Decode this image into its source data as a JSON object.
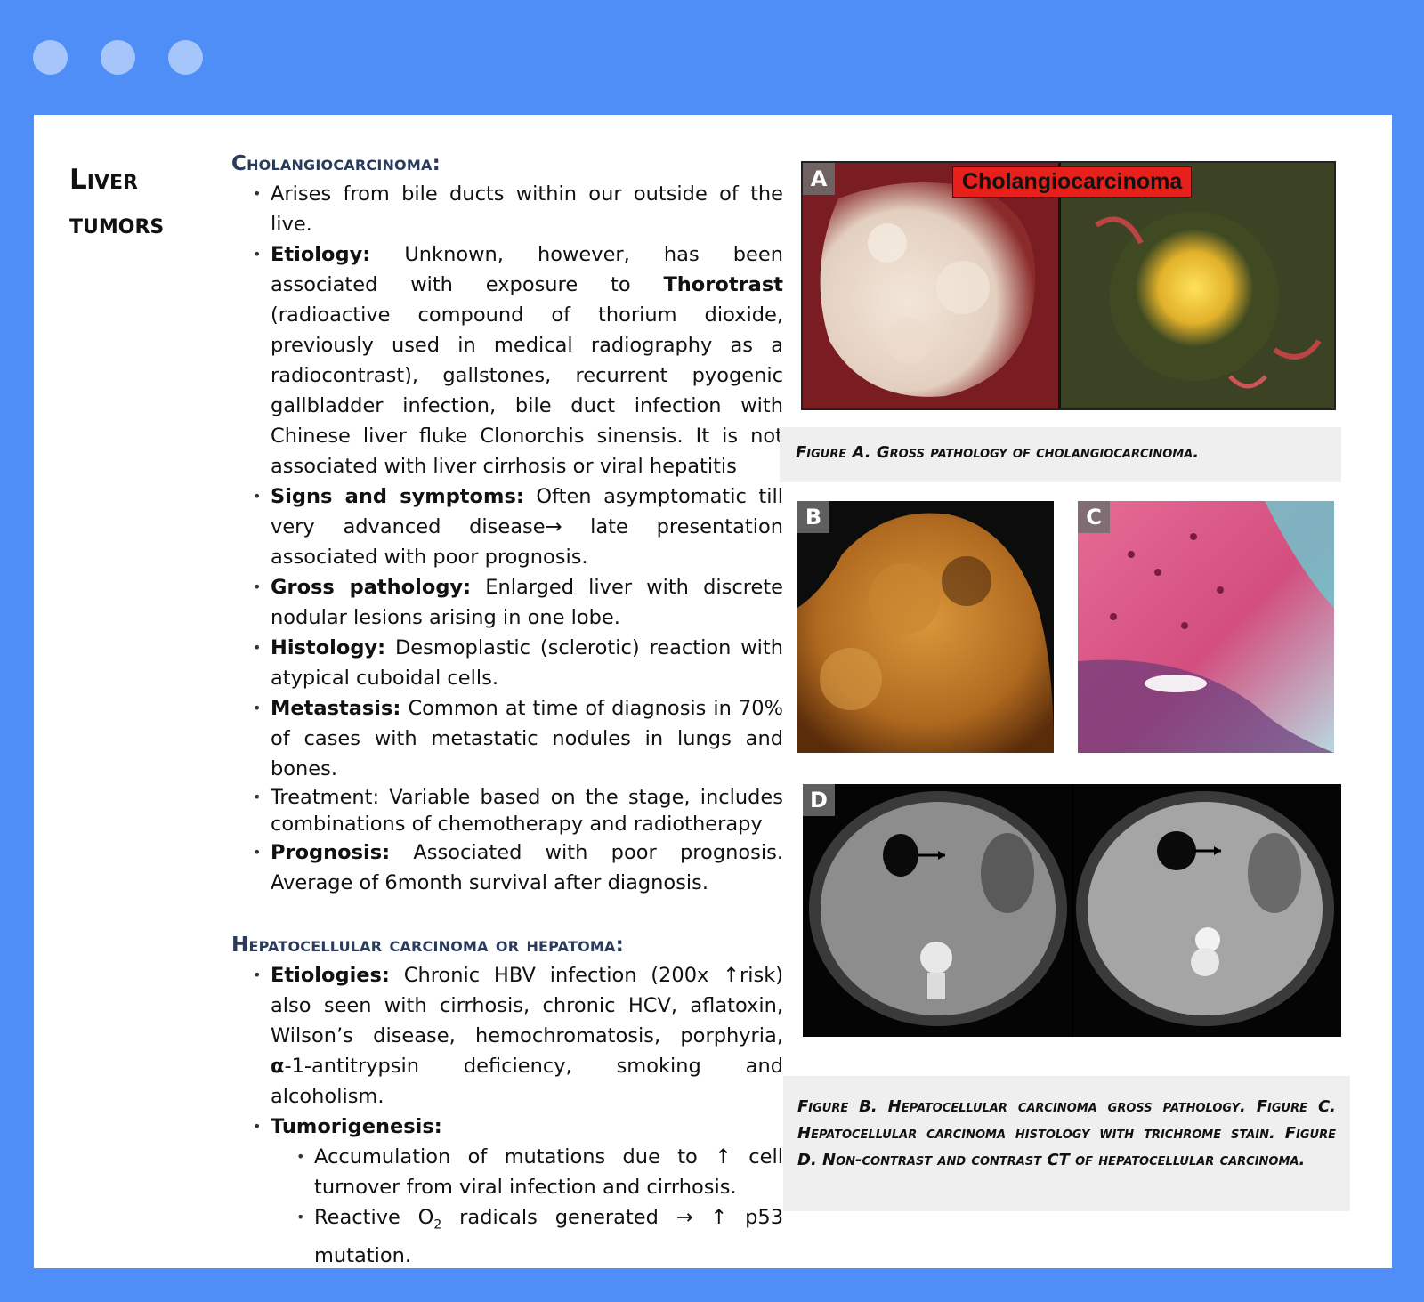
{
  "window": {
    "dots": 3
  },
  "sidebar": {
    "title_line1": "Liver",
    "title_line2": "tumors"
  },
  "cholangio": {
    "title": "Cholangiocarcinoma:",
    "b1": "Arises from bile ducts within our outside of the live.",
    "b2_label": "Etiology:",
    "b2_text1": " Unknown, however, has been associated with exposure to ",
    "b2_bold2": "Thorotrast",
    "b2_text2": " (radioactive compound of thorium dioxide, previously used in medical radiography as a radiocontrast), gallstones, recurrent pyogenic gallbladder infection, bile duct infection with Chinese liver fluke Clonorchis sinensis. It is not associated with liver cirrhosis or viral hepatitis",
    "b3_label": "Signs and symptoms:",
    "b3_text": " Often asymptomatic till very advanced disease→ late presentation associated with poor prognosis.",
    "b4_label": "Gross pathology:",
    "b4_text": " Enlarged liver with discrete nodular lesions arising in one lobe.",
    "b5_label": "Histology:",
    "b5_text": " Desmoplastic (sclerotic) reaction with atypical cuboidal cells.",
    "b6_label": "Metastasis:",
    "b6_text": " Common at time of diagnosis in 70% of cases with metastatic nodules in lungs and bones.",
    "b7": "Treatment: Variable based on the stage, includes combinations of chemotherapy and radiotherapy",
    "b8_label": "Prognosis:",
    "b8_text": " Associated with poor prognosis. Average of 6month survival after diagnosis."
  },
  "hcc": {
    "title": "Hepatocellular carcinoma or hepatoma:",
    "b1_label": "Etiologies:",
    "b1_text": " Chronic HBV infection (200x ↑risk) also seen with cirrhosis, chronic HCV, aflatoxin, Wilson’s disease, hemochromatosis, porphyria, ",
    "b1_alpha": "α",
    "b1_text2": "-1-antitrypsin deficiency, smoking and alcoholism.",
    "b2_label": "Tumorigenesis:",
    "s1": "Accumulation of mutations due to ↑ cell turnover from viral infection and cirrhosis.",
    "s2_pre": "Reactive O",
    "s2_sub": "2",
    "s2_post": " radicals generated → ↑ p53 mutation."
  },
  "figures": {
    "a_label": "A",
    "a_banner": "Cholangiocarcinoma",
    "a_caption": "Figure A. Gross pathology of cholangiocarcinoma.",
    "b_label": "B",
    "c_label": "C",
    "d_label": "D",
    "bcd_caption": "Figure B. Hepatocellular carcinoma gross pathology. Figure C.  Hepatocellular carcinoma histology with trichrome stain. Figure D. Non-contrast and contrast CT of hepatocellular carcinoma."
  },
  "colors": {
    "frame": "#4f8ef7",
    "heading": "#2a3b5c",
    "caption_bg": "#efefef"
  }
}
